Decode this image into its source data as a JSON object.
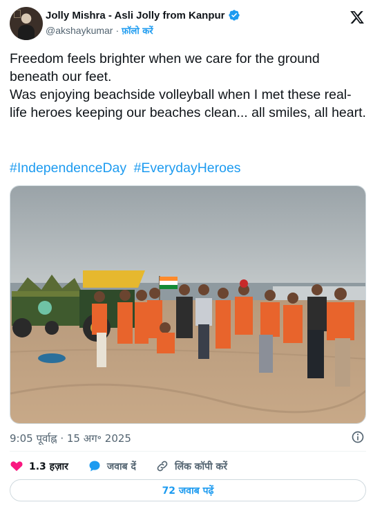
{
  "author": {
    "display_name": "Jolly Mishra - Asli Jolly from Kanpur",
    "handle": "@akshaykumar",
    "separator": "·",
    "follow_label": "फ़ॉलो करें",
    "verified_icon": "verified-badge-icon"
  },
  "tweet": {
    "lines": [
      "Freedom feels brighter when we care for the ground beneath our feet.",
      "Was enjoying beachside volleyball when I met these real-life heroes keeping our beaches clean... all smiles, all heart."
    ],
    "hashtags": [
      "#IndependenceDay",
      "#EverydayHeroes"
    ]
  },
  "meta": {
    "time": "9:05 पूर्वाह्न",
    "separator": "·",
    "date": "15 अग॰ 2025"
  },
  "actions": {
    "like_count": "1.3 हज़ार",
    "reply_label": "जवाब दें",
    "copy_link_label": "लिंक कॉपी करें"
  },
  "read_replies_label": "72 जवाब पढ़ें",
  "colors": {
    "accent": "#1d9bf0",
    "like": "#f91880",
    "text_primary": "#0f1419",
    "text_secondary": "#536471"
  }
}
